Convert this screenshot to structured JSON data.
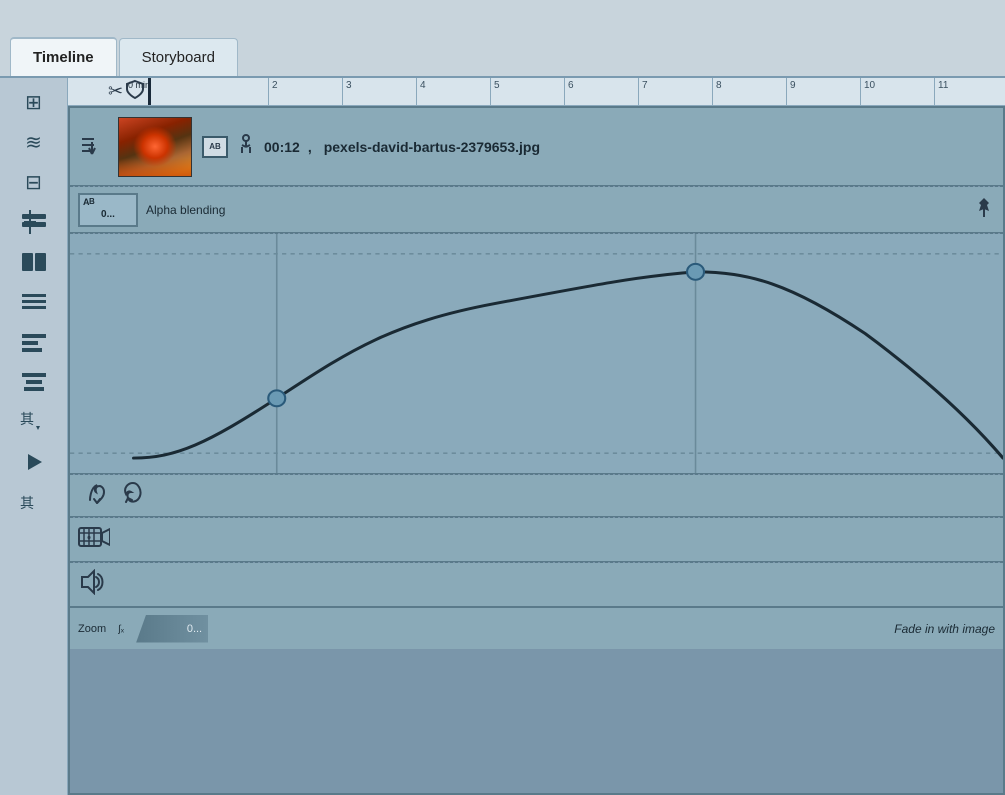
{
  "tabs": [
    {
      "label": "Timeline",
      "active": true
    },
    {
      "label": "Storyboard",
      "active": false
    }
  ],
  "sidebar": {
    "icons": [
      {
        "name": "grid-icon",
        "symbol": "⊞"
      },
      {
        "name": "layers-icon",
        "symbol": "≡"
      },
      {
        "name": "filter-icon",
        "symbol": "⊟"
      },
      {
        "name": "add-track-icon",
        "symbol": "⊞"
      },
      {
        "name": "split-icon",
        "symbol": "⊡"
      },
      {
        "name": "list-icon",
        "symbol": "≣"
      },
      {
        "name": "align-icon",
        "symbol": "▬"
      },
      {
        "name": "stack-icon",
        "symbol": "▬"
      },
      {
        "name": "subtitle-icon",
        "symbol": "其"
      },
      {
        "name": "play-icon",
        "symbol": "▶"
      },
      {
        "name": "trim-icon",
        "symbol": "其"
      }
    ]
  },
  "ruler": {
    "marks": [
      "0 min",
      "2",
      "3",
      "4",
      "5",
      "6",
      "7",
      "8",
      "9",
      "10",
      "11"
    ]
  },
  "track": {
    "time": "00:12",
    "filename": "pexels-david-bartus-2379653.jpg",
    "alpha_label": "Alpha blending",
    "alpha_value": "0...",
    "zoom_label": "Zoom",
    "zoom_value": "0...",
    "fade_label": "Fade in with image"
  }
}
